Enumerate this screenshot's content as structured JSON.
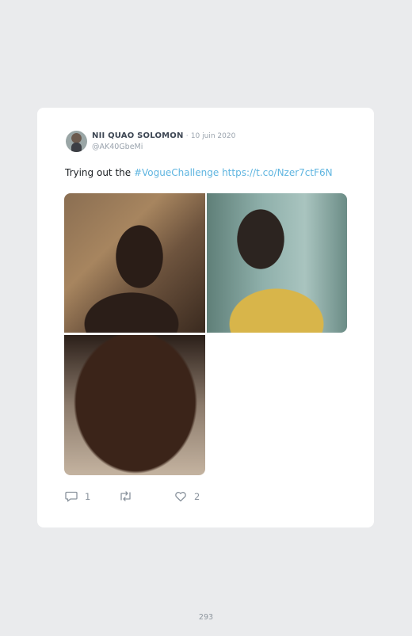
{
  "tweet": {
    "author_name": "NII QUAO SOLOMON",
    "date_separator": "·",
    "date": "10 juin 2020",
    "handle": "@AK40GbeMi",
    "text_plain": "Trying out the ",
    "hashtag": "#VogueChallenge",
    "link": "https://t.co/Nzer7ctF6N"
  },
  "actions": {
    "reply_icon": "speech-bubble-icon",
    "reply_count": "1",
    "retweet_icon": "retweet-icon",
    "like_icon": "heart-icon",
    "like_count": "2"
  },
  "page": {
    "number": "293"
  }
}
